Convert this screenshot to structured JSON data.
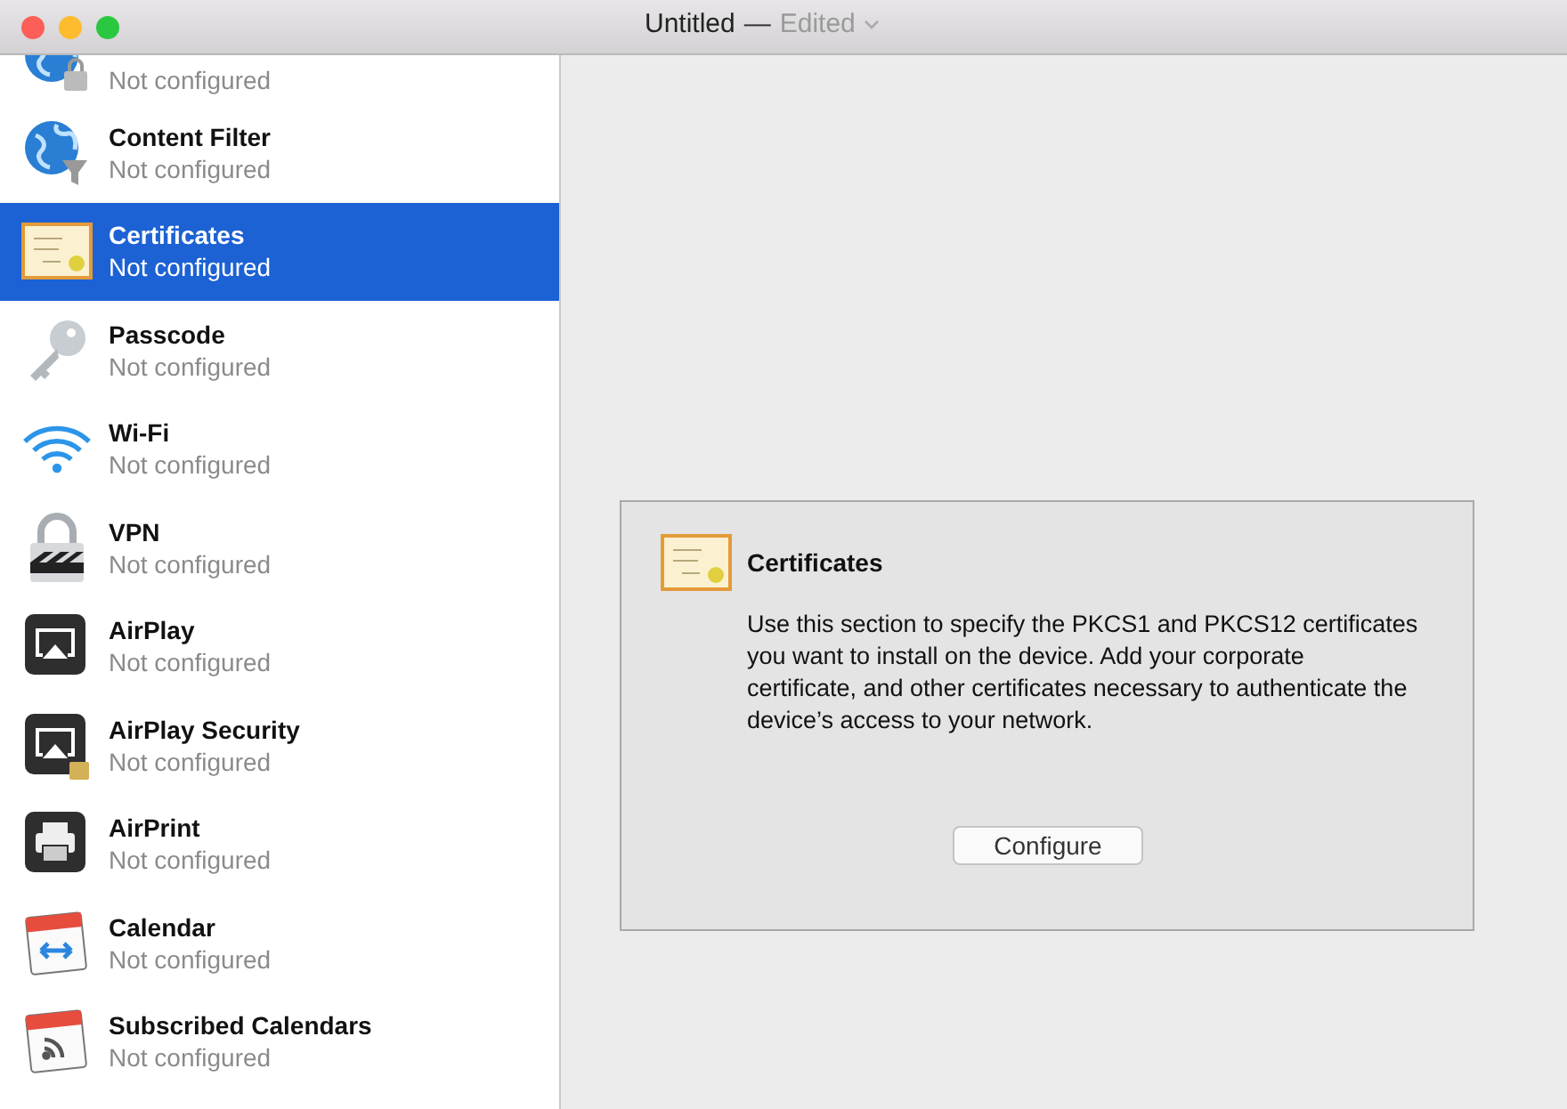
{
  "window": {
    "title": "Untitled",
    "separator": "—",
    "status": "Edited"
  },
  "sidebar": {
    "items": [
      {
        "kind": "globe-lock",
        "subtitle": "Not configured",
        "selected": false
      },
      {
        "kind": "globe-filter",
        "title": "Content Filter",
        "subtitle": "Not configured",
        "selected": false
      },
      {
        "kind": "certificate",
        "title": "Certificates",
        "subtitle": "Not configured",
        "selected": true
      },
      {
        "kind": "key",
        "title": "Passcode",
        "subtitle": "Not configured",
        "selected": false
      },
      {
        "kind": "wifi",
        "title": "Wi-Fi",
        "subtitle": "Not configured",
        "selected": false
      },
      {
        "kind": "lock",
        "title": "VPN",
        "subtitle": "Not configured",
        "selected": false
      },
      {
        "kind": "airplay",
        "title": "AirPlay",
        "subtitle": "Not configured",
        "selected": false
      },
      {
        "kind": "airplay-lock",
        "title": "AirPlay Security",
        "subtitle": "Not configured",
        "selected": false
      },
      {
        "kind": "printer",
        "title": "AirPrint",
        "subtitle": "Not configured",
        "selected": false
      },
      {
        "kind": "calendar",
        "title": "Calendar",
        "subtitle": "Not configured",
        "selected": false
      },
      {
        "kind": "calendar-feed",
        "title": "Subscribed Calendars",
        "subtitle": "Not configured",
        "selected": false
      }
    ]
  },
  "panel": {
    "title": "Certificates",
    "description": "Use this section to specify the PKCS1 and PKCS12 certificates you want to install on the device. Add your corporate certificate, and other certificates necessary to authenticate the device’s access to your network.",
    "button": "Configure"
  }
}
